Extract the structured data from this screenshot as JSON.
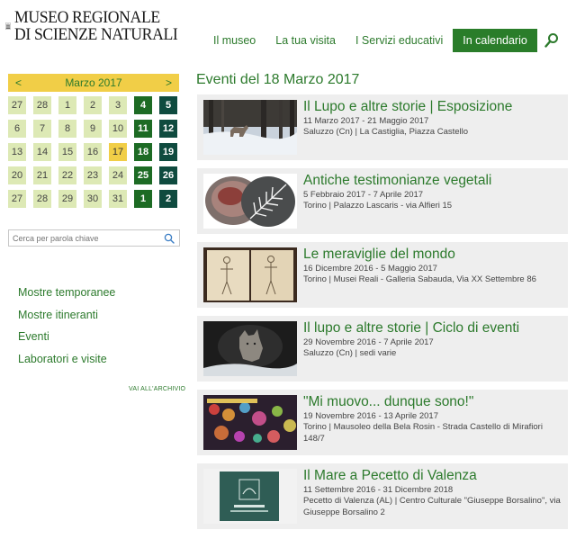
{
  "header": {
    "logo_line1": "MUSEO REGIONALE",
    "logo_line2": "DI SCIENZE NATURALI",
    "nav": [
      "Il museo",
      "La tua visita",
      "I Servizi educativi",
      "In calendario"
    ],
    "active_nav": "In calendario",
    "accent_color": "#2a7d2a"
  },
  "calendar": {
    "month_label": "Marzo 2017",
    "prev": "<",
    "next": ">",
    "weeks": [
      [
        {
          "d": "27",
          "s": "out"
        },
        {
          "d": "28",
          "s": "out"
        },
        {
          "d": "1",
          "s": "in"
        },
        {
          "d": "2",
          "s": "in"
        },
        {
          "d": "3",
          "s": "in"
        },
        {
          "d": "4",
          "s": "ev"
        },
        {
          "d": "5",
          "s": "ev-dark"
        }
      ],
      [
        {
          "d": "6",
          "s": "in"
        },
        {
          "d": "7",
          "s": "in"
        },
        {
          "d": "8",
          "s": "in"
        },
        {
          "d": "9",
          "s": "in"
        },
        {
          "d": "10",
          "s": "in"
        },
        {
          "d": "11",
          "s": "ev"
        },
        {
          "d": "12",
          "s": "ev-dark"
        }
      ],
      [
        {
          "d": "13",
          "s": "in"
        },
        {
          "d": "14",
          "s": "in"
        },
        {
          "d": "15",
          "s": "in"
        },
        {
          "d": "16",
          "s": "in"
        },
        {
          "d": "17",
          "s": "today"
        },
        {
          "d": "18",
          "s": "ev"
        },
        {
          "d": "19",
          "s": "ev-dark"
        }
      ],
      [
        {
          "d": "20",
          "s": "in"
        },
        {
          "d": "21",
          "s": "in"
        },
        {
          "d": "22",
          "s": "in"
        },
        {
          "d": "23",
          "s": "in"
        },
        {
          "d": "24",
          "s": "in"
        },
        {
          "d": "25",
          "s": "ev"
        },
        {
          "d": "26",
          "s": "ev-dark"
        }
      ],
      [
        {
          "d": "27",
          "s": "in"
        },
        {
          "d": "28",
          "s": "in"
        },
        {
          "d": "29",
          "s": "in"
        },
        {
          "d": "30",
          "s": "in"
        },
        {
          "d": "31",
          "s": "in"
        },
        {
          "d": "1",
          "s": "ev"
        },
        {
          "d": "2",
          "s": "ev-dark"
        }
      ]
    ]
  },
  "search": {
    "placeholder": "Cerca per parola chiave"
  },
  "sidebar": {
    "links": [
      "Mostre temporanee",
      "Mostre itineranti",
      "Eventi",
      "Laboratori e visite"
    ],
    "archive": "VAI ALL'ARCHIVIO"
  },
  "main": {
    "title": "Eventi del 18 Marzo 2017",
    "events": [
      {
        "title": "Il Lupo e altre storie | Esposizione",
        "dates": "11 Marzo 2017 - 21 Maggio 2017",
        "place": "Saluzzo (Cn) | La Castiglia, Piazza Castello",
        "thumb": "wolf-snow"
      },
      {
        "title": "Antiche testimonianze vegetali",
        "dates": "5 Febbraio 2017 - 7 Aprile 2017",
        "place": "Torino | Palazzo Lascaris - via Alfieri 15",
        "thumb": "plant-fossils"
      },
      {
        "title": "Le meraviglie del mondo",
        "dates": "16 Dicembre 2016 - 5 Maggio 2017",
        "place": "Torino | Musei Reali - Galleria Sabauda, Via XX Settembre 86",
        "thumb": "anatomy-book"
      },
      {
        "title": "Il lupo e altre storie | Ciclo di eventi",
        "dates": "29 Novembre 2016 - 7 Aprile 2017",
        "place": "Saluzzo (Cn) | sedi varie",
        "thumb": "wolf-rocks"
      },
      {
        "title": "\"Mi muovo... dunque sono!\"",
        "dates": "19 Novembre 2016 - 13 Aprile 2017",
        "place": "Torino | Mausoleo della Bela Rosin - Strada Castello di Mirafiori 148/7",
        "thumb": "bokeh-lights"
      },
      {
        "title": "Il Mare a Pecetto di Valenza",
        "dates": "11 Settembre 2016 - 31 Dicembre 2018",
        "place": "Pecetto di Valenza (AL) | Centro Culturale \"Giuseppe Borsalino\", via Giuseppe Borsalino 2",
        "thumb": "il-mare-poster"
      }
    ]
  }
}
